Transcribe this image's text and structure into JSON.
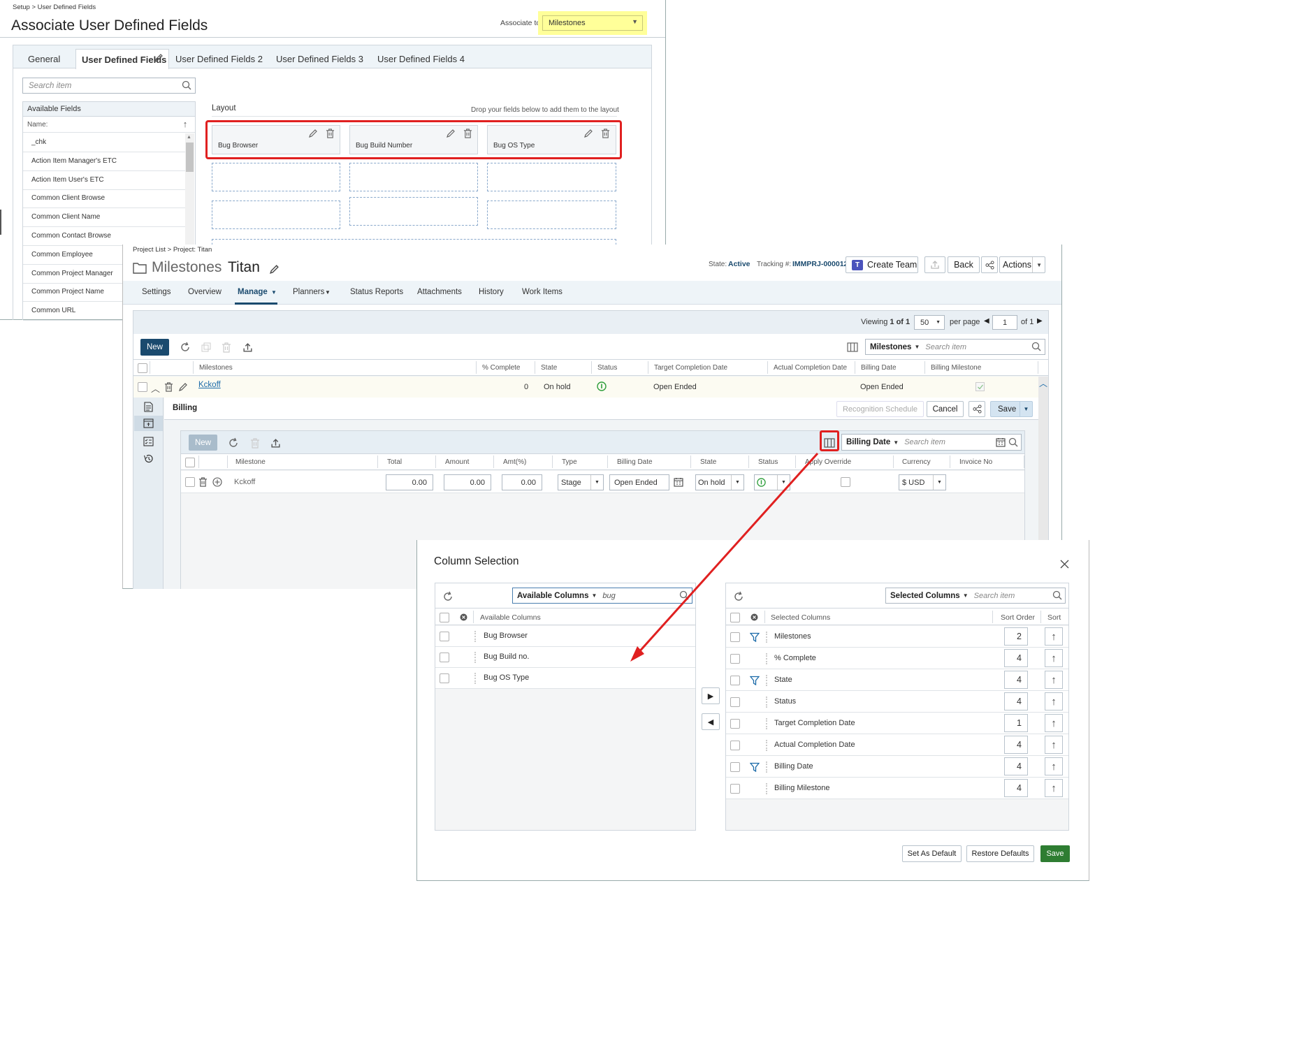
{
  "udf": {
    "breadcrumb": "Setup > User Defined Fields",
    "title": "Associate User Defined Fields",
    "associate_label": "Associate to:",
    "associate_value": "Milestones",
    "tabs": [
      "General",
      "User Defined Fields",
      "User Defined Fields 2",
      "User Defined Fields 3",
      "User Defined Fields 4"
    ],
    "search_placeholder": "Search item",
    "available_header": "Available Fields",
    "name_label": "Name:",
    "fields": [
      "_chk",
      "Action Item Manager's ETC",
      "Action Item User's ETC",
      "Common Client Browse",
      "Common Client Name",
      "Common Contact Browse",
      "Common Employee",
      "Common Project Manager",
      "Common Project Name",
      "Common URL"
    ],
    "layout_label": "Layout",
    "drop_hint": "Drop your fields below to add them to the layout",
    "layout_fields": [
      "Bug Browser",
      "Bug Build Number",
      "Bug OS Type"
    ]
  },
  "project": {
    "breadcrumb": "Project List > Project: Titan",
    "title_prefix": "Milestones",
    "title_name": "Titan",
    "state_label": "State:",
    "state_value": "Active",
    "tracking_label": "Tracking #:",
    "tracking_value": "IMMPRJ-000012",
    "create_team": "Create Team",
    "back": "Back",
    "actions": "Actions",
    "nav": [
      "Settings",
      "Overview",
      "Manage",
      "Planners",
      "Status Reports",
      "Attachments",
      "History",
      "Work Items"
    ],
    "viewing": "Viewing",
    "viewing_range": "1 of 1",
    "per_page_value": "50",
    "per_page": "per page",
    "page_value": "1",
    "of_pages": "of 1",
    "new": "New",
    "grid_select": "Milestones",
    "search_placeholder": "Search item",
    "columns": [
      "Milestones",
      "% Complete",
      "State",
      "Status",
      "Target Completion Date",
      "Actual Completion Date",
      "Billing Date",
      "Billing Milestone"
    ],
    "row": {
      "name": "Kckoff",
      "complete": "0",
      "state": "On hold",
      "target": "Open Ended",
      "billing_date": "Open Ended"
    },
    "billing_title": "Billing",
    "recognition": "Recognition Schedule",
    "cancel": "Cancel",
    "save": "Save",
    "sub": {
      "new": "New",
      "select": "Billing Date",
      "search_placeholder": "Search item",
      "columns": [
        "Milestone",
        "Total",
        "Amount",
        "Amt(%)",
        "Type",
        "Billing Date",
        "State",
        "Status",
        "Apply Override",
        "Currency",
        "Invoice No"
      ],
      "row": {
        "milestone": "Kckoff",
        "total": "0.00",
        "amount": "0.00",
        "amt_pct": "0.00",
        "type": "Stage",
        "billing_date": "Open Ended",
        "state": "On hold",
        "currency": "$ USD"
      }
    }
  },
  "dialog": {
    "title": "Column Selection",
    "available_select": "Available Columns",
    "available_search": "bug",
    "available_header": "Available Columns",
    "available": [
      "Bug Browser",
      "Bug Build no.",
      "Bug OS Type"
    ],
    "selected_select": "Selected Columns",
    "selected_search_placeholder": "Search item",
    "selected_header": "Selected Columns",
    "sort_order_header": "Sort Order",
    "sort_header": "Sort",
    "selected": [
      {
        "name": "Milestones",
        "order": "2",
        "filter": true
      },
      {
        "name": "% Complete",
        "order": "4",
        "filter": false
      },
      {
        "name": "State",
        "order": "4",
        "filter": true
      },
      {
        "name": "Status",
        "order": "4",
        "filter": false
      },
      {
        "name": "Target Completion Date",
        "order": "1",
        "filter": false
      },
      {
        "name": "Actual Completion Date",
        "order": "4",
        "filter": false
      },
      {
        "name": "Billing Date",
        "order": "4",
        "filter": true
      },
      {
        "name": "Billing Milestone",
        "order": "4",
        "filter": false
      }
    ],
    "set_default": "Set As Default",
    "restore_defaults": "Restore Defaults",
    "save": "Save"
  },
  "colors": {
    "accent": "#1a4a6e",
    "link": "#1a6aa8",
    "save_green": "#2e7d32",
    "highlight": "#ffff99",
    "red_box": "#e02020"
  }
}
